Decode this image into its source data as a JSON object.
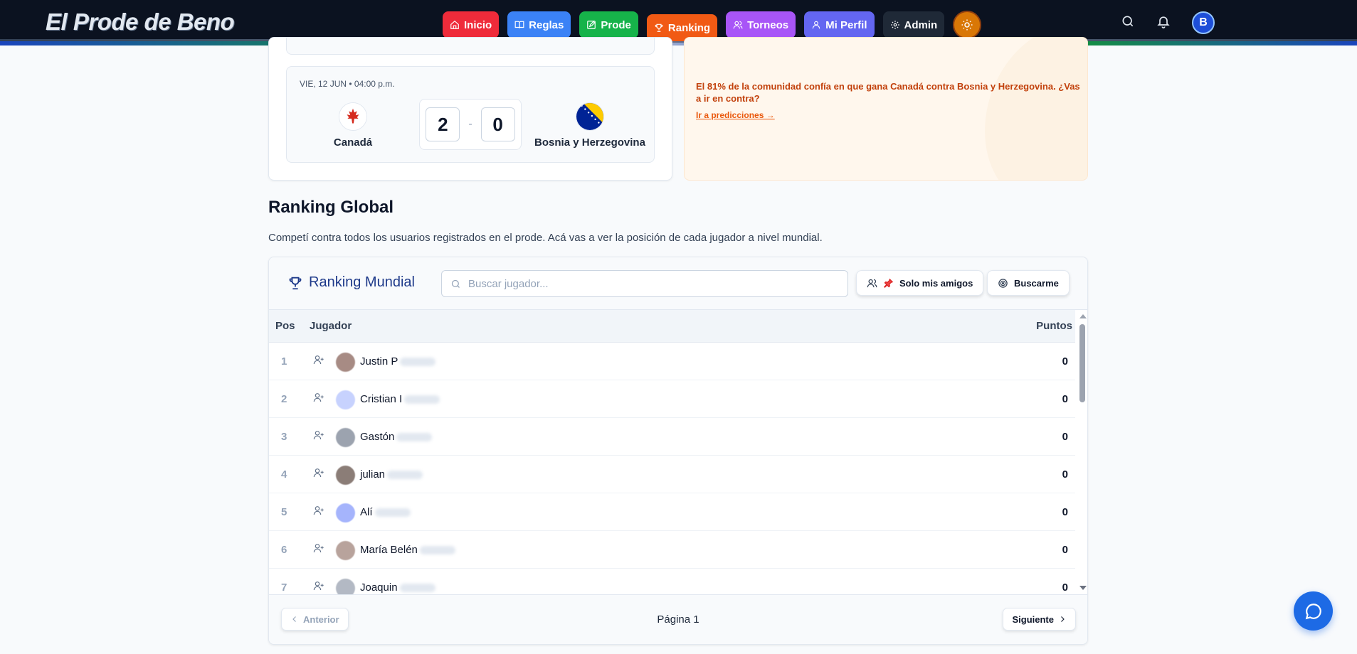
{
  "brand": "El Prode de Beno",
  "nav": {
    "inicio": "Inicio",
    "reglas": "Reglas",
    "prode": "Prode",
    "ranking": "Ranking",
    "torneos": "Torneos",
    "perfil": "Mi Perfil",
    "admin": "Admin"
  },
  "user_initial": "B",
  "match": {
    "date": "VIE, 12 JUN • 04:00 p.m.",
    "home_team": "Canadá",
    "away_team": "Bosnia y Herzegovina",
    "home_score": "2",
    "away_score": "0",
    "separator": "-"
  },
  "tip": {
    "text": "El 81% de la comunidad confía en que gana Canadá contra Bosnia y Herzegovina. ¿Vas a ir en contra?",
    "link": "Ir a predicciones →"
  },
  "ranking_section": {
    "title": "Ranking Global",
    "description": "Competí contra todos los usuarios registrados en el prode. Acá vas a ver la posición de cada jugador a nivel mundial."
  },
  "ranking_card": {
    "title": "Ranking Mundial",
    "search_placeholder": "Buscar jugador...",
    "friends_button": "Solo mis amigos",
    "find_me_button": "Buscarme",
    "columns": {
      "pos": "Pos",
      "player": "Jugador",
      "points": "Puntos"
    },
    "rows": [
      {
        "pos": "1",
        "name": "Justin P",
        "points": "0",
        "avatar_color": "#a78b84"
      },
      {
        "pos": "2",
        "name": "Cristian I",
        "points": "0",
        "avatar_color": "#c7d2fe"
      },
      {
        "pos": "3",
        "name": "Gastón",
        "points": "0",
        "avatar_color": "#9ca3af"
      },
      {
        "pos": "4",
        "name": "julian",
        "points": "0",
        "avatar_color": "#8b7d77"
      },
      {
        "pos": "5",
        "name": "Alí",
        "points": "0",
        "avatar_color": "#a5b4fc"
      },
      {
        "pos": "6",
        "name": "María Belén",
        "points": "0",
        "avatar_color": "#b8a39c"
      },
      {
        "pos": "7",
        "name": "Joaquin",
        "points": "0",
        "avatar_color": "#b3b9c4"
      }
    ],
    "prev_button": "Anterior",
    "page_label": "Página 1",
    "next_button": "Siguiente"
  }
}
